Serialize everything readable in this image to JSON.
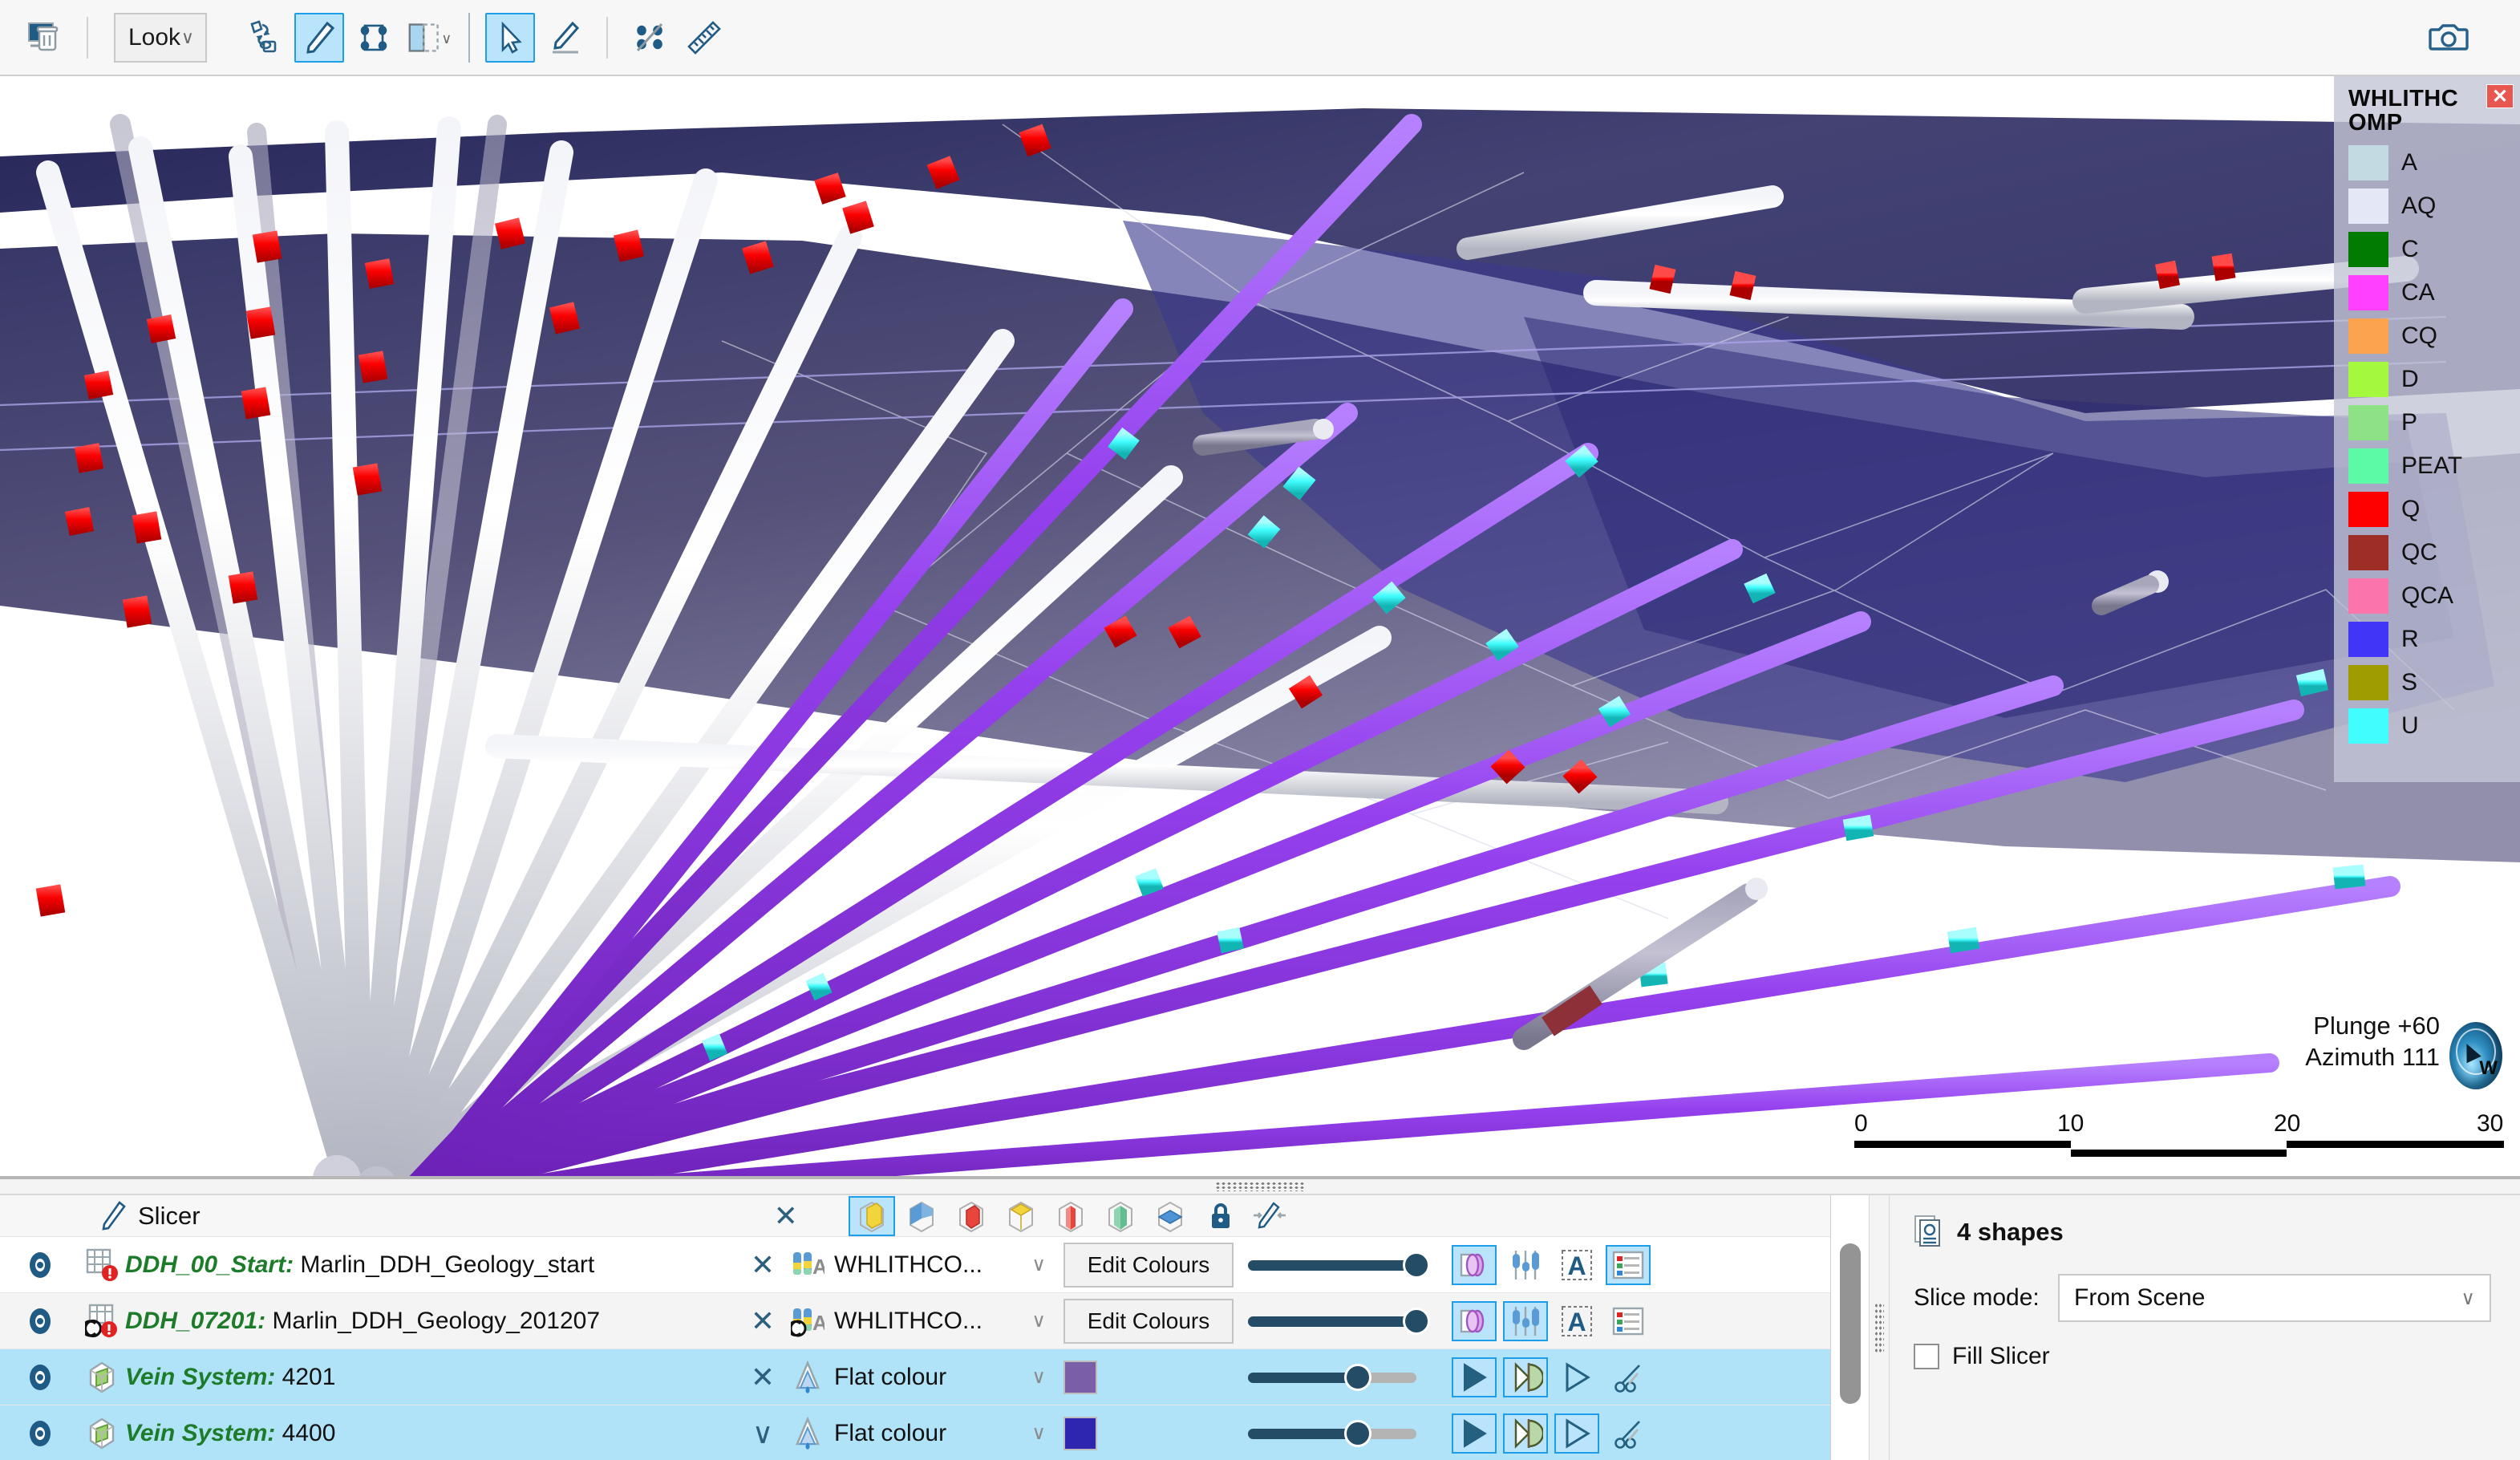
{
  "toolbar": {
    "clear_scene_icon": "clear-scene-icon",
    "look_label": "Look",
    "look_chevron": "∨",
    "buttons": [
      {
        "name": "swap-slicer-icon",
        "active": false
      },
      {
        "name": "slicer-pen-icon",
        "active": true
      },
      {
        "name": "move-object-icon",
        "active": false
      },
      {
        "name": "slice-half-icon",
        "active": false
      },
      {
        "name": "select-arrow-icon",
        "active": true
      },
      {
        "name": "draw-polyline-icon",
        "active": false
      },
      {
        "name": "slice-line-icon",
        "active": false
      },
      {
        "name": "measure-ruler-icon",
        "active": false
      }
    ],
    "camera_icon": "camera-icon"
  },
  "legend": {
    "title": "WHLITHCOMP",
    "close_label": "✕",
    "items": [
      {
        "label": "A",
        "color": "#c3dae3"
      },
      {
        "label": "AQ",
        "color": "#e4e7f5"
      },
      {
        "label": "C",
        "color": "#017c01"
      },
      {
        "label": "CA",
        "color": "#ff40ff"
      },
      {
        "label": "CQ",
        "color": "#fca34f"
      },
      {
        "label": "D",
        "color": "#a4f93e"
      },
      {
        "label": "P",
        "color": "#8fe185"
      },
      {
        "label": "PEAT",
        "color": "#5cf9a6"
      },
      {
        "label": "Q",
        "color": "#fe0000"
      },
      {
        "label": "QC",
        "color": "#9e2d28"
      },
      {
        "label": "QCA",
        "color": "#fb74ab"
      },
      {
        "label": "R",
        "color": "#4136f7"
      },
      {
        "label": "S",
        "color": "#9e9c01"
      },
      {
        "label": "U",
        "color": "#41fdfd"
      }
    ]
  },
  "viewport": {
    "orientation": {
      "plunge": "Plunge +60",
      "azimuth": "Azimuth 111"
    },
    "scalebar": {
      "ticks": [
        "0",
        "10",
        "20",
        "30"
      ]
    },
    "compass_letter": "W"
  },
  "bottom": {
    "slicer": {
      "label": "Slicer",
      "pen_icon": "slicer-pen-icon",
      "remove_label": "✕",
      "tools": [
        {
          "name": "slice-yellow-solid-icon",
          "active": true
        },
        {
          "name": "slice-blue-front-icon",
          "active": false
        },
        {
          "name": "slice-red-solid-icon",
          "active": false
        },
        {
          "name": "slice-yellow-wire-icon",
          "active": false
        },
        {
          "name": "slice-red-mid-icon",
          "active": false
        },
        {
          "name": "slice-green-mid-icon",
          "active": false
        },
        {
          "name": "slice-blue-plane-icon",
          "active": false
        },
        {
          "name": "lock-icon",
          "active": false
        },
        {
          "name": "collapse-slicer-icon",
          "active": false
        }
      ]
    },
    "layers": [
      {
        "row_style": "white",
        "eye_icon": "visibility-eye-icon",
        "type_icon": "drillhole-table-warning-icon",
        "name": "DDH_00_Start:",
        "value": "Marlin_DDH_Geology_start",
        "remove_label": "✕",
        "attr_icon": "drillhole-colour-attr-icon",
        "attribute": "WHLITHCO...",
        "attr_chevron": "∨",
        "button_label": "Edit Colours",
        "swatch": null,
        "opacity": 100,
        "tools": [
          {
            "name": "cylinder-view-icon",
            "active": true
          },
          {
            "name": "downhole-plot-icon",
            "active": false
          },
          {
            "name": "text-labels-icon",
            "active": false
          },
          {
            "name": "legend-list-icon",
            "active": true
          }
        ]
      },
      {
        "row_style": "alt",
        "eye_icon": "visibility-eye-icon",
        "type_icon": "drillhole-table-composite-warning-icon",
        "name": "DDH_07201:",
        "value": "Marlin_DDH_Geology_201207",
        "remove_label": "✕",
        "attr_icon": "drillhole-colour-attr-composite-icon",
        "attribute": "WHLITHCO...",
        "attr_chevron": "∨",
        "button_label": "Edit Colours",
        "swatch": null,
        "opacity": 100,
        "tools": [
          {
            "name": "cylinder-view-icon",
            "active": true
          },
          {
            "name": "downhole-plot-icon",
            "active": true
          },
          {
            "name": "text-labels-icon",
            "active": false
          },
          {
            "name": "legend-list-icon",
            "active": false
          }
        ]
      },
      {
        "row_style": "sel",
        "eye_icon": "visibility-eye-icon",
        "type_icon": "mesh-cube-icon",
        "name": "Vein System:",
        "value": "4201",
        "remove_label": "✕",
        "attr_icon": "flat-colour-droplet-icon",
        "attribute": "Flat colour",
        "attr_chevron": "∨",
        "button_label": null,
        "swatch": "#7a5fa8",
        "opacity": 65,
        "tools": [
          {
            "name": "solid-fill-icon",
            "active": true
          },
          {
            "name": "backface-shading-icon",
            "active": true
          },
          {
            "name": "wireframe-icon",
            "active": false
          },
          {
            "name": "scissors-clip-icon",
            "active": false
          }
        ]
      },
      {
        "row_style": "sel",
        "eye_icon": "visibility-eye-icon",
        "type_icon": "mesh-cube-icon",
        "name": "Vein System:",
        "value": "4400",
        "remove_label": "∨",
        "attr_icon": "flat-colour-droplet-icon",
        "attribute": "Flat colour",
        "attr_chevron": "∨",
        "button_label": null,
        "swatch": "#2f26b0",
        "opacity": 65,
        "tools": [
          {
            "name": "solid-fill-icon",
            "active": true
          },
          {
            "name": "backface-shading-icon",
            "active": true
          },
          {
            "name": "wireframe-icon",
            "active": true
          },
          {
            "name": "scissors-clip-icon",
            "active": false
          }
        ]
      }
    ],
    "properties": {
      "icon": "shapes-stack-icon",
      "title": "4 shapes",
      "slice_mode_label": "Slice mode:",
      "slice_mode_value": "From Scene",
      "slice_mode_chevron": "∨",
      "fill_slicer_label": "Fill Slicer",
      "fill_slicer_checked": false
    }
  },
  "colors": {
    "accent_blue": "#1e9ee8",
    "accent_dark": "#244c66",
    "selection": "#b0e2f8",
    "layer_name_green": "#1c7c2a"
  }
}
